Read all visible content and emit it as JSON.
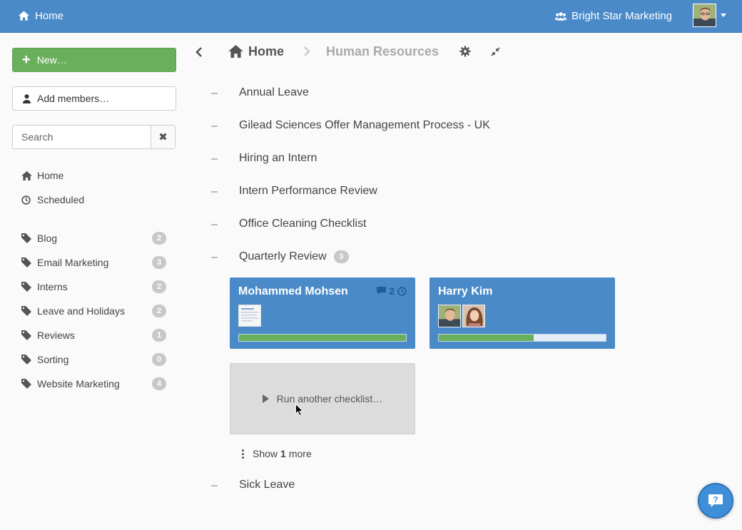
{
  "topbar": {
    "home_label": "Home",
    "org_name": "Bright Star Marketing",
    "bg_color": "#4a8ac9"
  },
  "sidebar": {
    "new_button": "New…",
    "add_members_button": "Add members…",
    "search": {
      "placeholder": "Search",
      "value": ""
    },
    "nav": [
      {
        "label": "Home",
        "icon": "home-icon"
      },
      {
        "label": "Scheduled",
        "icon": "clock-icon"
      }
    ],
    "tags": [
      {
        "label": "Blog",
        "count": "2"
      },
      {
        "label": "Email Marketing",
        "count": "3"
      },
      {
        "label": "Interns",
        "count": "2"
      },
      {
        "label": "Leave and Holidays",
        "count": "2"
      },
      {
        "label": "Reviews",
        "count": "1"
      },
      {
        "label": "Sorting",
        "count": "0"
      },
      {
        "label": "Website Marketing",
        "count": "4"
      }
    ]
  },
  "breadcrumb": {
    "home": "Home",
    "current": "Human Resources"
  },
  "checklists": [
    {
      "title": "Annual Leave"
    },
    {
      "title": "Gilead Sciences Offer Management Process - UK"
    },
    {
      "title": "Hiring an Intern"
    },
    {
      "title": "Intern Performance Review"
    },
    {
      "title": "Office Cleaning Checklist"
    },
    {
      "title": "Quarterly Review",
      "count": "3"
    },
    {
      "title": "Sick Leave"
    }
  ],
  "runs": [
    {
      "name": "Mohammed Mohsen",
      "comments": "2",
      "progress": 1.0
    },
    {
      "name": "Harry Kim",
      "progress": 0.57
    }
  ],
  "run_another": "Run another checklist…",
  "show_more": {
    "prefix": "Show",
    "count": "1",
    "suffix": "more"
  },
  "colors": {
    "accent": "#4a8ac9",
    "success": "#6ab05c",
    "badge": "#c8c8c8"
  }
}
